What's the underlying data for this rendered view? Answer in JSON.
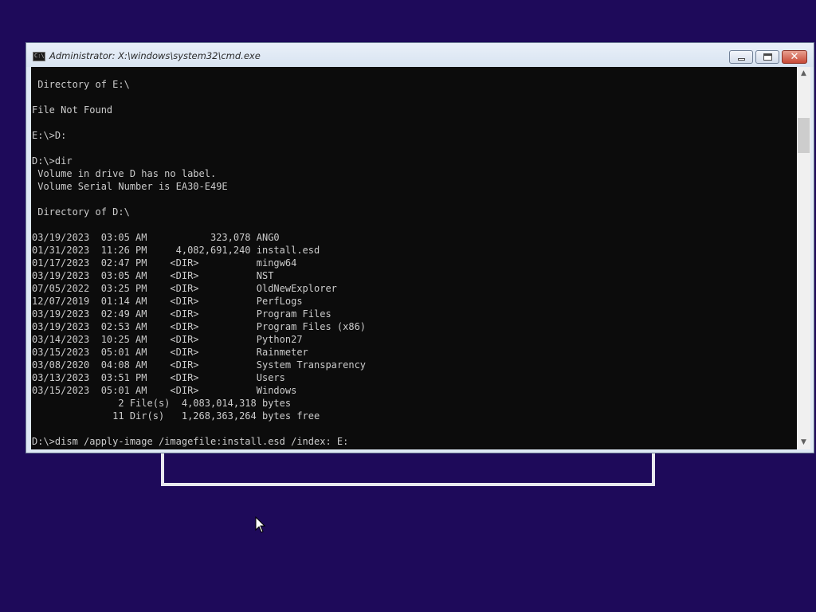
{
  "window": {
    "title": "Administrator: X:\\windows\\system32\\cmd.exe",
    "icon_text": "C:\\",
    "controls": {
      "minimize": "minimize",
      "maximize": "maximize",
      "close": "✕"
    }
  },
  "console": {
    "lines": [
      " Directory of E:\\",
      "",
      "File Not Found",
      "",
      "E:\\>D:",
      "",
      "D:\\>dir",
      " Volume in drive D has no label.",
      " Volume Serial Number is EA30-E49E",
      "",
      " Directory of D:\\",
      "",
      "03/19/2023  03:05 AM           323,078 ANG0",
      "01/31/2023  11:26 PM     4,082,691,240 install.esd",
      "01/17/2023  02:47 PM    <DIR>          mingw64",
      "03/19/2023  03:05 AM    <DIR>          NST",
      "07/05/2022  03:25 PM    <DIR>          OldNewExplorer",
      "12/07/2019  01:14 AM    <DIR>          PerfLogs",
      "03/19/2023  02:49 AM    <DIR>          Program Files",
      "03/19/2023  02:53 AM    <DIR>          Program Files (x86)",
      "03/14/2023  10:25 AM    <DIR>          Python27",
      "03/15/2023  05:01 AM    <DIR>          Rainmeter",
      "03/08/2020  04:08 AM    <DIR>          System Transparency",
      "03/13/2023  03:51 PM    <DIR>          Users",
      "03/15/2023  05:01 AM    <DIR>          Windows",
      "               2 File(s)  4,083,014,318 bytes",
      "              11 Dir(s)   1,268,363,264 bytes free",
      "",
      "D:\\>dism /apply-image /imagefile:install.esd /index: E:"
    ]
  },
  "scrollbar": {
    "up_arrow": "▲",
    "down_arrow": "▼"
  },
  "colors": {
    "desktop_background": "#1e0a5a",
    "console_background": "#0c0c0c",
    "console_text": "#cccccc",
    "close_button": "#c74a38"
  }
}
